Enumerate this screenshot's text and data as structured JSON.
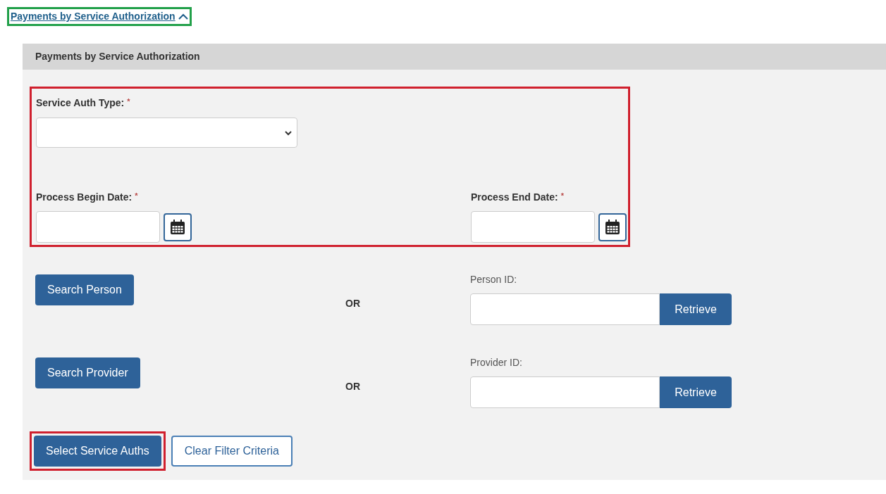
{
  "section_link": {
    "label": "Payments by Service Authorization",
    "expanded": true,
    "highlighted": true
  },
  "panel": {
    "title": "Payments by Service Authorization",
    "criteria": {
      "highlighted": true,
      "service_auth_type": {
        "label": "Service Auth Type:",
        "required_mark": "*"
      },
      "begin_date": {
        "label": "Process Begin Date:",
        "required_mark": "*"
      },
      "end_date": {
        "label": "Process End Date:",
        "required_mark": "*"
      }
    },
    "lookups": [
      {
        "search_button": "Search Person",
        "or": "OR",
        "id_label": "Person ID:",
        "retrieve_button": "Retrieve"
      },
      {
        "search_button": "Search Provider",
        "or": "OR",
        "id_label": "Provider ID:",
        "retrieve_button": "Retrieve"
      }
    ],
    "actions": [
      {
        "label": "Select Service Auths",
        "kind": "primary",
        "highlighted": true
      },
      {
        "label": "Clear Filter Criteria",
        "kind": "secondary",
        "highlighted": false
      }
    ]
  }
}
